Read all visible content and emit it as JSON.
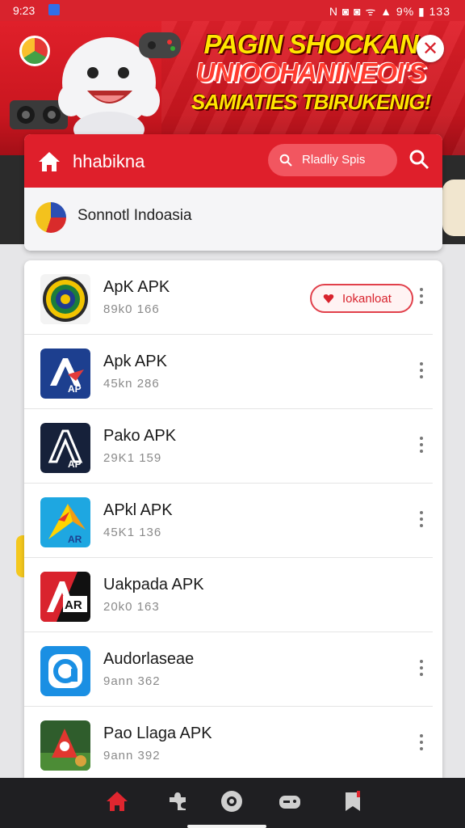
{
  "status_bar": {
    "time": "9:23",
    "right_indicators": "N ◙ ◙ ᯤ ▲ 9% ▮ 133"
  },
  "banner": {
    "line1": "PAGIN SHOCKAN",
    "line2": "UNIOOHANINEOI'S",
    "line3": "SAMIATIES TBIRUKENIG!",
    "close_icon": "close-icon"
  },
  "header": {
    "brand": "hhabikna",
    "search_placeholder": "Rladliy Spis",
    "home_icon": "home-icon",
    "search_icon": "search-icon"
  },
  "region": {
    "label": "Sonnotl Indoasia"
  },
  "apps": [
    {
      "name": "ApK  APK",
      "meta": "89k0  166",
      "download_label": "Iokanloat"
    },
    {
      "name": "Apk  APK",
      "meta": "45kn  286"
    },
    {
      "name": "Pako  APK",
      "meta": "29K1  159"
    },
    {
      "name": "APkl APK",
      "meta": "45K1  136"
    },
    {
      "name": "Uakpada  APK",
      "meta": "20k0  163"
    },
    {
      "name": "Audorlaseae",
      "meta": "9ann  362"
    },
    {
      "name": "Pao  Llaga APK",
      "meta": "9ann  392"
    }
  ],
  "bottom_nav": [
    "home-icon",
    "puzzle-icon",
    "settings-icon",
    "gamepad-icon",
    "bookmark-icon"
  ],
  "colors": {
    "brand_red": "#df1f2b",
    "status_red": "#d8232d",
    "nav_bg": "#1f1f22"
  }
}
